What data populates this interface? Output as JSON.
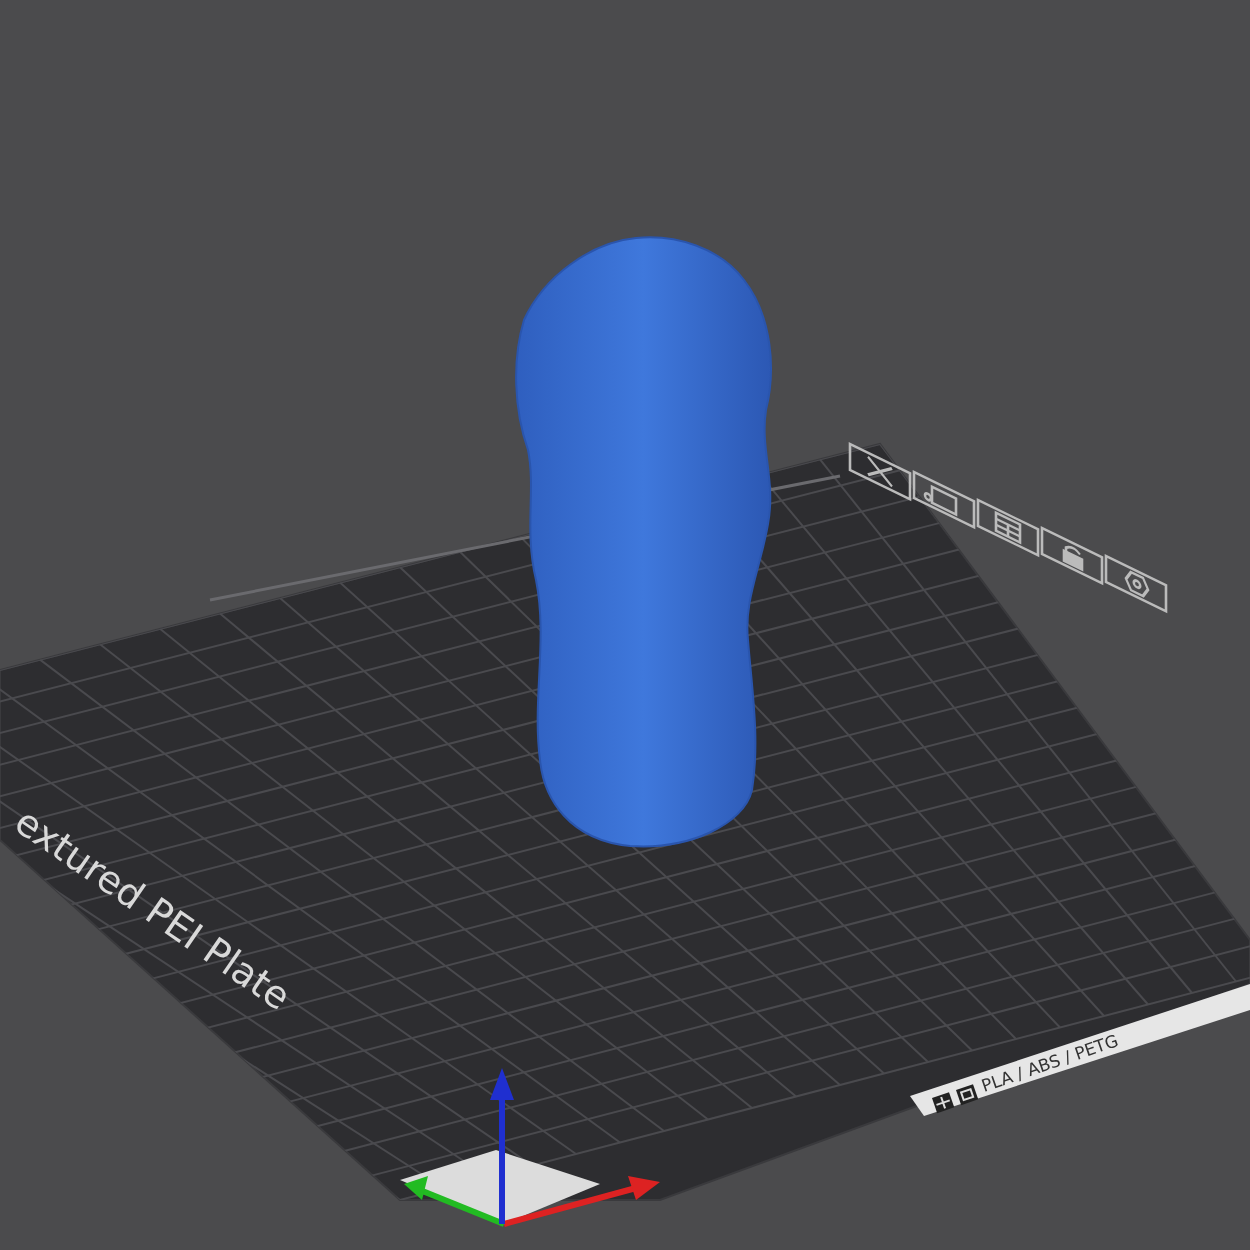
{
  "plate": {
    "name": "extured PEI Plate",
    "filament_label": "PLA / ABS / PETG"
  }
}
